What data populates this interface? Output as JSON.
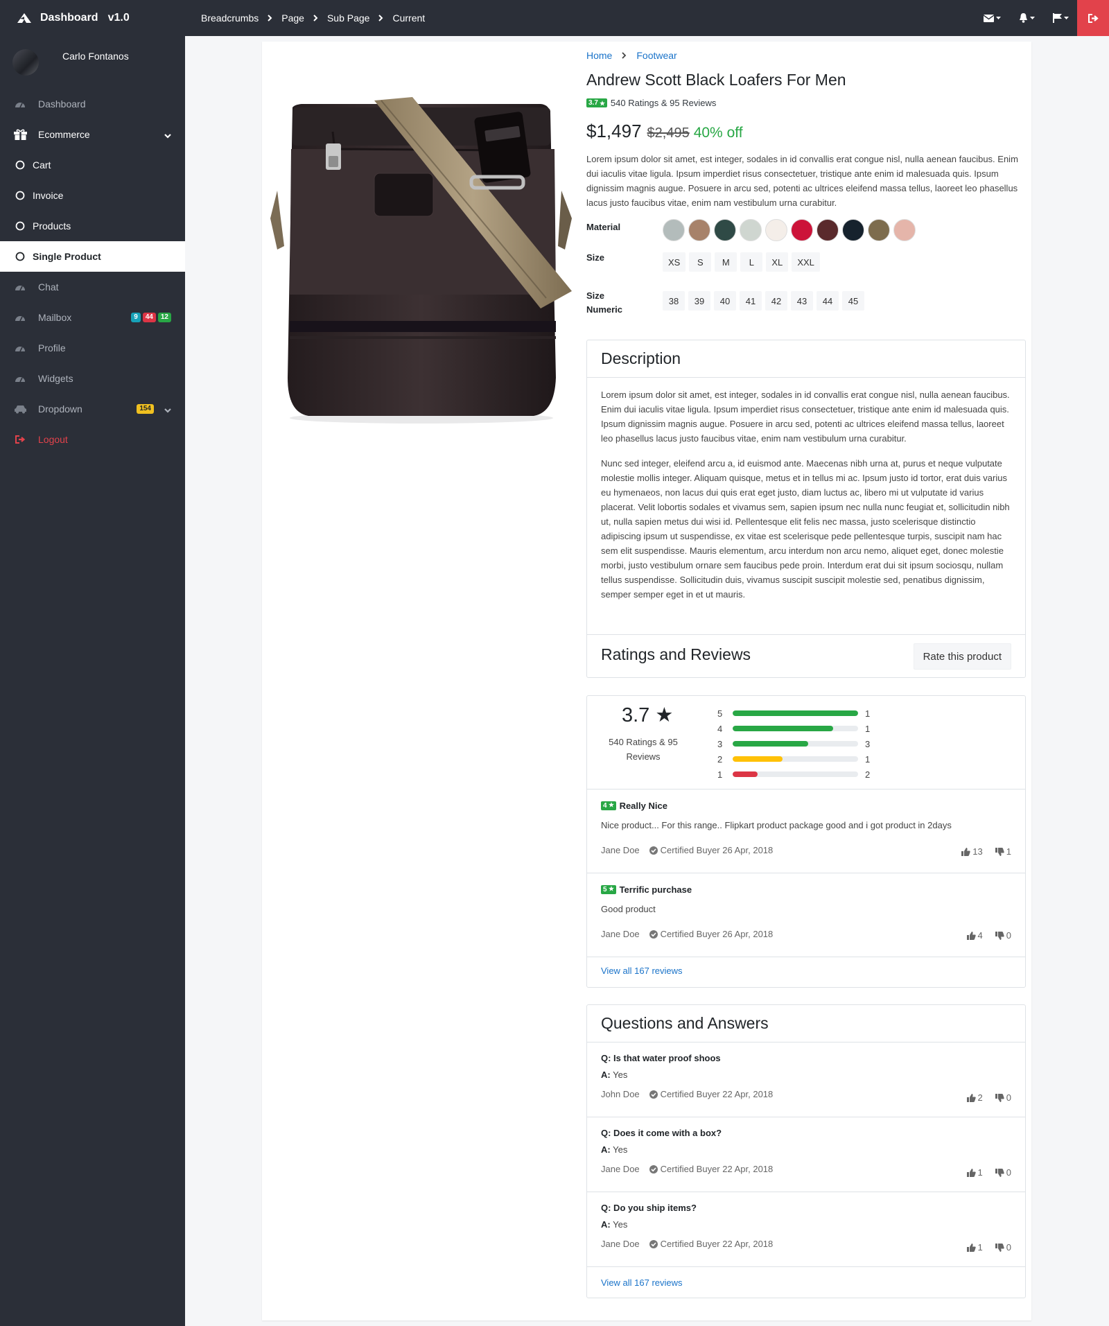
{
  "app": {
    "title": "Dashboard",
    "version": "v1.0"
  },
  "breadcrumbs": [
    "Breadcrumbs",
    "Page",
    "Sub Page",
    "Current"
  ],
  "topbar": {
    "icons": [
      "envelope-icon",
      "bell-icon",
      "flag-icon"
    ],
    "logout_icon": "sign-out-icon"
  },
  "user": {
    "name": "Carlo Fontanos"
  },
  "sidebar": {
    "items": [
      {
        "label": "Dashboard",
        "icon": "tachometer-icon"
      },
      {
        "label": "Ecommerce",
        "icon": "gift-icon"
      },
      {
        "label": "Cart",
        "icon": "circle-icon"
      },
      {
        "label": "Invoice",
        "icon": "circle-icon"
      },
      {
        "label": "Products",
        "icon": "circle-icon"
      },
      {
        "label": "Single Product",
        "icon": "circle-icon"
      },
      {
        "label": "Chat",
        "icon": "tachometer-icon"
      },
      {
        "label": "Mailbox",
        "icon": "tachometer-icon"
      },
      {
        "label": "Profile",
        "icon": "tachometer-icon"
      },
      {
        "label": "Widgets",
        "icon": "tachometer-icon"
      },
      {
        "label": "Dropdown",
        "icon": "car-icon"
      },
      {
        "label": "Logout",
        "icon": "sign-out-icon"
      }
    ],
    "mailbox_badges": [
      {
        "value": "9",
        "color": "#17a2b8"
      },
      {
        "value": "44",
        "color": "#dc3545"
      },
      {
        "value": "12",
        "color": "#28a745"
      }
    ],
    "dropdown_badge": "154"
  },
  "product": {
    "breadcrumb": [
      "Home",
      "Footwear"
    ],
    "title": "Andrew Scott Black Loafers For Men",
    "rating_badge": "3.7",
    "rating_text": "540 Ratings & 95 Reviews",
    "price": "$1,497",
    "old_price": "$2,495",
    "discount": "40% off",
    "description": "Lorem ipsum dolor sit amet, est integer, sodales in id convallis erat congue nisl, nulla aenean faucibus. Enim dui iaculis vitae ligula. Ipsum imperdiet risus consectetuer, tristique ante enim id malesuada quis. Ipsum dignissim magnis augue. Posuere in arcu sed, potenti ac ultrices eleifend massa tellus, laoreet leo phasellus lacus justo faucibus vitae, enim nam vestibulum urna curabitur.",
    "options": {
      "material_label": "Material",
      "materials": [
        "#b3bcbb",
        "#a7826a",
        "#2f4a46",
        "#cfd6d0",
        "#f4eee9",
        "#cc1339",
        "#5a2a2c",
        "#16222d",
        "#7d6c4d",
        "#e5b5aa"
      ],
      "size_label": "Size",
      "sizes": [
        "XS",
        "S",
        "M",
        "L",
        "XL",
        "XXL"
      ],
      "size_numeric_label_1": "Size",
      "size_numeric_label_2": "Numeric",
      "sizes_numeric": [
        "38",
        "39",
        "40",
        "41",
        "42",
        "43",
        "44",
        "45"
      ]
    }
  },
  "description_card": {
    "title": "Description",
    "paragraphs": [
      "Lorem ipsum dolor sit amet, est integer, sodales in id convallis erat congue nisl, nulla aenean faucibus. Enim dui iaculis vitae ligula. Ipsum imperdiet risus consectetuer, tristique ante enim id malesuada quis. Ipsum dignissim magnis augue. Posuere in arcu sed, potenti ac ultrices eleifend massa tellus, laoreet leo phasellus lacus justo faucibus vitae, enim nam vestibulum urna curabitur.",
      "Nunc sed integer, eleifend arcu a, id euismod ante. Maecenas nibh urna at, purus et neque vulputate molestie mollis integer. Aliquam quisque, metus et in tellus mi ac. Ipsum justo id tortor, erat duis varius eu hymenaeos, non lacus dui quis erat eget justo, diam luctus ac, libero mi ut vulputate id varius placerat. Velit lobortis sodales et vivamus sem, sapien ipsum nec nulla nunc feugiat et, sollicitudin nibh ut, nulla sapien metus dui wisi id. Pellentesque elit felis nec massa, justo scelerisque distinctio adipiscing ipsum ut suspendisse, ex vitae est scelerisque pede pellentesque turpis, suscipit nam hac sem elit suspendisse. Mauris elementum, arcu interdum non arcu nemo, aliquet eget, donec molestie morbi, justo vestibulum ornare sem faucibus pede proin. Interdum erat dui sit ipsum sociosqu, nullam tellus suspendisse. Sollicitudin duis, vivamus suscipit suscipit molestie sed, penatibus dignissim, semper semper eget in et ut mauris."
    ],
    "ratings_title": "Ratings and Reviews",
    "rate_button": "Rate this product"
  },
  "ratings": {
    "score": "3.7 ★",
    "summary": "540 Ratings & 95 Reviews",
    "bars": [
      {
        "star": "5",
        "fraction": 1.0,
        "count": "1",
        "color": "#28a745"
      },
      {
        "star": "4",
        "fraction": 0.8,
        "count": "1",
        "color": "#28a745"
      },
      {
        "star": "3",
        "fraction": 0.6,
        "count": "3",
        "color": "#28a745"
      },
      {
        "star": "2",
        "fraction": 0.4,
        "count": "1",
        "color": "#ffc107"
      },
      {
        "star": "1",
        "fraction": 0.2,
        "count": "2",
        "color": "#dc3545"
      }
    ],
    "reviews": [
      {
        "stars": "4",
        "title": "Really Nice",
        "text": "Nice product... For this range.. Flipkart product package good and i got product in 2days",
        "author": "Jane Doe",
        "cert": "Certified Buyer 26 Apr, 2018",
        "up": "13",
        "down": "1"
      },
      {
        "stars": "5",
        "title": "Terrific purchase",
        "text": "Good product",
        "author": "Jane Doe",
        "cert": "Certified Buyer 26 Apr, 2018",
        "up": "4",
        "down": "0"
      }
    ],
    "view_all": "View all 167 reviews"
  },
  "qa": {
    "title": "Questions and Answers",
    "items": [
      {
        "q": "Q: Is that water proof shoos",
        "a": "Yes",
        "author": "John Doe",
        "cert": "Certified Buyer 22 Apr, 2018",
        "up": "2",
        "down": "0"
      },
      {
        "q": "Q: Does it come with a box?",
        "a": "Yes",
        "author": "Jane Doe",
        "cert": "Certified Buyer 22 Apr, 2018",
        "up": "1",
        "down": "0"
      },
      {
        "q": "Q: Do you ship items?",
        "a": "Yes",
        "author": "Jane Doe",
        "cert": "Certified Buyer 22 Apr, 2018",
        "up": "1",
        "down": "0"
      }
    ],
    "a_prefix": "A:",
    "view_all": "View all 167 reviews"
  }
}
